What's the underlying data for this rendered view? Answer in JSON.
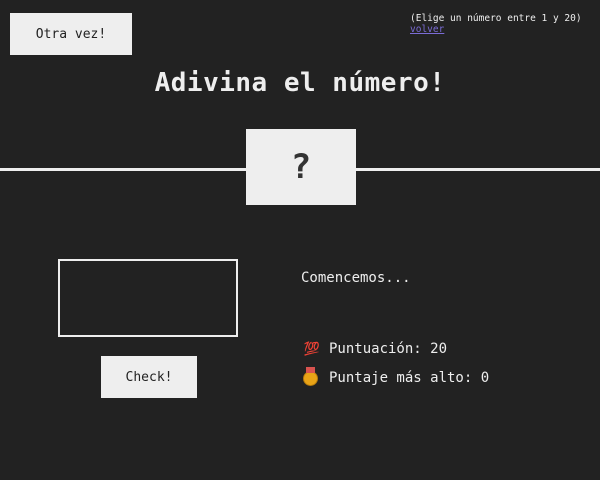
{
  "header": {
    "again_label": "Otra vez!",
    "hint": "(Elige un número entre 1 y 20)",
    "back_link": "volver"
  },
  "main": {
    "title": "Adivina el número!",
    "secret": "?"
  },
  "left": {
    "guess_value": "",
    "check_label": "Check!"
  },
  "right": {
    "message": "Comencemos...",
    "score_label": "Puntuación:",
    "score_value": "20",
    "highscore_label": "Puntaje más alto:",
    "highscore_value": "0",
    "score_icon": "hundred-points-emoji",
    "highscore_icon": "medal-emoji"
  },
  "colors": {
    "background": "#222222",
    "foreground": "#eeeeee",
    "link": "#7b6cd6"
  }
}
